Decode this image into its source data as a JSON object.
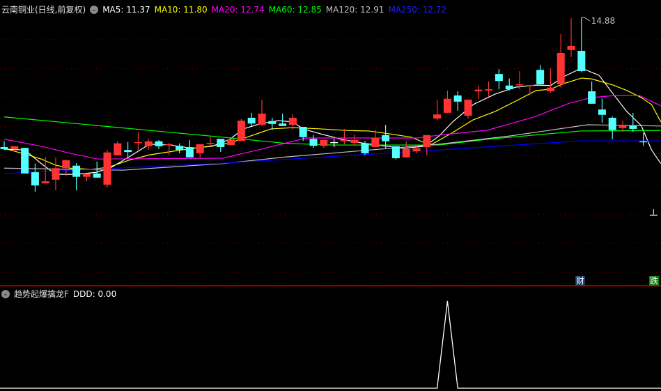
{
  "header": {
    "title": "云南铜业(日线,前复权)",
    "ma": [
      {
        "label": "MA5: 11.37",
        "color": "#ffffff"
      },
      {
        "label": "MA10: 11.80",
        "color": "#ffff00"
      },
      {
        "label": "MA20: 12.74",
        "color": "#ff00ff"
      },
      {
        "label": "MA60: 12.85",
        "color": "#00ff00"
      },
      {
        "label": "MA120: 12.91",
        "color": "#c0c0c0"
      },
      {
        "label": "MA250: 12.72",
        "color": "#0000ff"
      }
    ]
  },
  "indicator": {
    "title": "趋势起爆擒龙F",
    "value_label": "DDD: 0.00"
  },
  "badges": {
    "cai": "财",
    "die": "跌"
  },
  "colors": {
    "up": "#ff3333",
    "down": "#54ffff",
    "grid": "#8b0000",
    "separator": "#c00000"
  },
  "chart_data": {
    "type": "candlestick",
    "high_label": "14.88",
    "ylim": [
      10.0,
      15.3
    ],
    "candles": [
      [
        11.74,
        11.69,
        11.88,
        11.67
      ],
      [
        11.69,
        11.76,
        11.76,
        11.62
      ],
      [
        11.72,
        11.1,
        11.72,
        11.1
      ],
      [
        11.13,
        10.81,
        11.34,
        10.66
      ],
      [
        10.86,
        10.91,
        11.5,
        10.86
      ],
      [
        10.95,
        11.23,
        11.49,
        10.69
      ],
      [
        11.23,
        11.42,
        11.44,
        11.03
      ],
      [
        11.29,
        11.02,
        11.35,
        10.69
      ],
      [
        11.02,
        11.1,
        11.1,
        10.91
      ],
      [
        11.1,
        11.0,
        11.39,
        11.0
      ],
      [
        10.83,
        11.61,
        11.67,
        10.76
      ],
      [
        11.54,
        11.83,
        11.88,
        11.54
      ],
      [
        11.67,
        11.62,
        11.86,
        11.47
      ],
      [
        11.84,
        11.86,
        12.1,
        11.67
      ],
      [
        11.76,
        11.88,
        11.94,
        11.67
      ],
      [
        11.88,
        11.76,
        11.91,
        11.69
      ],
      [
        11.79,
        11.81,
        11.84,
        11.54
      ],
      [
        11.77,
        11.67,
        11.83,
        11.59
      ],
      [
        11.74,
        11.49,
        11.91,
        11.49
      ],
      [
        11.59,
        11.81,
        11.81,
        11.49
      ],
      [
        11.83,
        11.84,
        11.99,
        11.77
      ],
      [
        11.94,
        11.74,
        11.94,
        11.62
      ],
      [
        11.79,
        11.93,
        11.93,
        11.79
      ],
      [
        11.89,
        12.38,
        12.42,
        11.89
      ],
      [
        12.45,
        12.31,
        12.57,
        12.25
      ],
      [
        12.28,
        12.55,
        12.89,
        12.25
      ],
      [
        12.37,
        12.3,
        12.45,
        12.15
      ],
      [
        12.31,
        12.25,
        12.55,
        12.25
      ],
      [
        12.28,
        12.45,
        12.53,
        12.16
      ],
      [
        12.23,
        11.98,
        12.23,
        11.89
      ],
      [
        11.94,
        11.77,
        12.03,
        11.72
      ],
      [
        11.77,
        11.91,
        11.91,
        11.72
      ],
      [
        11.86,
        11.86,
        11.94,
        11.74
      ],
      [
        11.88,
        11.91,
        12.18,
        11.81
      ],
      [
        11.84,
        11.91,
        12.04,
        11.77
      ],
      [
        11.83,
        11.59,
        11.89,
        11.55
      ],
      [
        11.74,
        11.96,
        12.16,
        11.74
      ],
      [
        12.03,
        11.88,
        12.28,
        11.71
      ],
      [
        11.76,
        11.47,
        11.76,
        11.44
      ],
      [
        11.49,
        11.69,
        11.88,
        11.49
      ],
      [
        11.64,
        11.71,
        11.77,
        11.59
      ],
      [
        11.74,
        12.03,
        12.03,
        11.54
      ],
      [
        12.43,
        12.53,
        12.89,
        12.38
      ],
      [
        12.57,
        12.91,
        13.11,
        12.57
      ],
      [
        12.99,
        12.84,
        13.09,
        12.62
      ],
      [
        12.5,
        12.89,
        12.89,
        12.43
      ],
      [
        13.09,
        13.13,
        13.23,
        12.91
      ],
      [
        13.11,
        13.14,
        13.33,
        12.96
      ],
      [
        13.51,
        13.34,
        13.63,
        13.14
      ],
      [
        13.23,
        13.14,
        13.4,
        13.11
      ],
      [
        13.24,
        13.26,
        13.58,
        13.14
      ],
      [
        13.23,
        13.24,
        13.24,
        13.01
      ],
      [
        13.61,
        13.26,
        13.73,
        13.23
      ],
      [
        13.09,
        13.18,
        13.65,
        13.06
      ],
      [
        13.26,
        14.02,
        14.48,
        13.18
      ],
      [
        14.09,
        14.19,
        14.86,
        13.92
      ],
      [
        14.07,
        13.58,
        14.88,
        13.55
      ],
      [
        13.09,
        12.79,
        13.33,
        12.79
      ],
      [
        12.65,
        12.52,
        12.92,
        12.33
      ],
      [
        12.45,
        12.15,
        12.48,
        11.93
      ],
      [
        12.2,
        12.25,
        12.37,
        12.11
      ],
      [
        12.26,
        12.18,
        12.57,
        12.11
      ],
      [
        11.88,
        11.87,
        12.08,
        11.77
      ],
      [
        10.1,
        10.1,
        10.24,
        10.1
      ]
    ],
    "series": [
      {
        "name": "MA5",
        "color": "#ffffff",
        "points": [
          [
            0,
            11.69
          ],
          [
            2,
            11.67
          ],
          [
            3.6,
            11.34
          ],
          [
            5,
            11.08
          ],
          [
            7,
            11.08
          ],
          [
            9,
            11.13
          ],
          [
            10.4,
            11.25
          ],
          [
            12.1,
            11.5
          ],
          [
            14.1,
            11.81
          ],
          [
            16.1,
            11.79
          ],
          [
            18.2,
            11.71
          ],
          [
            20.2,
            11.76
          ],
          [
            21.9,
            11.93
          ],
          [
            23.2,
            12.18
          ],
          [
            24.9,
            12.31
          ],
          [
            26.6,
            12.38
          ],
          [
            28,
            12.35
          ],
          [
            29,
            12.18
          ],
          [
            30.7,
            12.06
          ],
          [
            32.7,
            11.93
          ],
          [
            34.7,
            11.84
          ],
          [
            37.1,
            11.76
          ],
          [
            38.8,
            11.71
          ],
          [
            40.8,
            11.76
          ],
          [
            42.2,
            12.01
          ],
          [
            43.5,
            12.35
          ],
          [
            45.5,
            12.77
          ],
          [
            47.6,
            13.02
          ],
          [
            49.6,
            13.19
          ],
          [
            51.6,
            13.24
          ],
          [
            53,
            13.23
          ],
          [
            54.3,
            13.45
          ],
          [
            56,
            13.65
          ],
          [
            57.7,
            13.48
          ],
          [
            59.1,
            13.02
          ],
          [
            60.4,
            12.6
          ],
          [
            61.8,
            12.26
          ],
          [
            62.8,
            11.67
          ],
          [
            63.7,
            11.34
          ]
        ]
      },
      {
        "name": "MA10",
        "color": "#ffff00",
        "points": [
          [
            0,
            11.71
          ],
          [
            2.3,
            11.55
          ],
          [
            3.6,
            11.45
          ],
          [
            5,
            11.3
          ],
          [
            6.4,
            11.23
          ],
          [
            8.4,
            11.2
          ],
          [
            10.1,
            11.25
          ],
          [
            12.1,
            11.42
          ],
          [
            14.1,
            11.55
          ],
          [
            17.2,
            11.67
          ],
          [
            19.9,
            11.76
          ],
          [
            21.9,
            11.84
          ],
          [
            23.9,
            12.01
          ],
          [
            25.9,
            12.18
          ],
          [
            28,
            12.21
          ],
          [
            30.7,
            12.18
          ],
          [
            33.4,
            12.14
          ],
          [
            35.4,
            12.13
          ],
          [
            37.4,
            12.06
          ],
          [
            39.5,
            11.98
          ],
          [
            40.8,
            11.84
          ],
          [
            41.5,
            11.81
          ],
          [
            43.5,
            12.09
          ],
          [
            45.5,
            12.4
          ],
          [
            47.6,
            12.6
          ],
          [
            49.6,
            12.85
          ],
          [
            51.6,
            13.11
          ],
          [
            53,
            13.14
          ],
          [
            54.3,
            13.28
          ],
          [
            56,
            13.41
          ],
          [
            57,
            13.39
          ],
          [
            59.1,
            13.24
          ],
          [
            60.4,
            13.11
          ],
          [
            61.8,
            12.94
          ],
          [
            62.8,
            12.77
          ],
          [
            63.7,
            12.35
          ]
        ]
      },
      {
        "name": "MA20",
        "color": "#ff00ff",
        "points": [
          [
            0,
            11.93
          ],
          [
            3.6,
            11.76
          ],
          [
            6.4,
            11.59
          ],
          [
            9.1,
            11.45
          ],
          [
            21.2,
            11.47
          ],
          [
            24.6,
            11.67
          ],
          [
            29.3,
            11.96
          ],
          [
            40.1,
            11.96
          ],
          [
            42.2,
            12.03
          ],
          [
            46.9,
            12.15
          ],
          [
            51.4,
            12.47
          ],
          [
            54.8,
            12.8
          ],
          [
            57,
            12.94
          ],
          [
            59.3,
            12.99
          ],
          [
            61.6,
            12.99
          ],
          [
            63.7,
            12.74
          ]
        ]
      },
      {
        "name": "MA60",
        "color": "#00ff00",
        "points": [
          [
            0,
            12.47
          ],
          [
            21.2,
            11.98
          ],
          [
            27.3,
            11.83
          ],
          [
            31.8,
            11.79
          ],
          [
            42.2,
            11.79
          ],
          [
            46.9,
            11.93
          ],
          [
            55.9,
            12.13
          ],
          [
            63.7,
            12.14
          ]
        ]
      },
      {
        "name": "MA120",
        "color": "#c0c0c0",
        "points": [
          [
            0,
            11.23
          ],
          [
            6.4,
            11.2
          ],
          [
            11.5,
            11.18
          ],
          [
            21.2,
            11.34
          ],
          [
            27.3,
            11.5
          ],
          [
            34.1,
            11.64
          ],
          [
            42.2,
            11.81
          ],
          [
            49.1,
            12.01
          ],
          [
            56.6,
            12.28
          ],
          [
            63.7,
            12.25
          ]
        ]
      },
      {
        "name": "MA250",
        "color": "#0000ff",
        "points": [
          [
            0,
            11.1
          ],
          [
            21.2,
            11.35
          ],
          [
            42.2,
            11.67
          ],
          [
            55.9,
            11.89
          ],
          [
            63.7,
            11.89
          ]
        ]
      }
    ],
    "indicator": {
      "name": "DDD",
      "ylim": [
        0,
        1
      ],
      "spike_index": 43,
      "spike_value": 1
    }
  }
}
